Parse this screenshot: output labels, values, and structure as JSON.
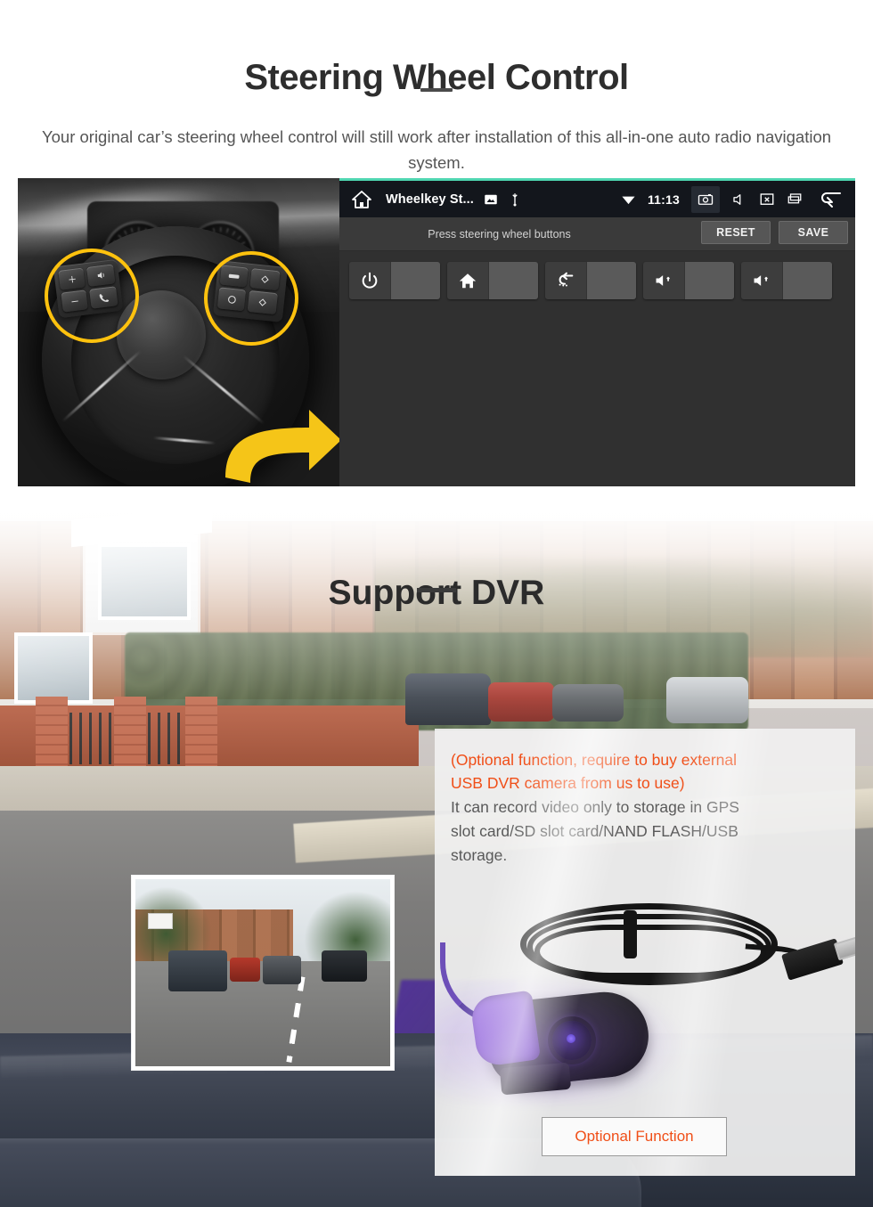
{
  "section1": {
    "title": "Steering Wheel Control",
    "subtitle": "Your original car’s steering wheel control will still work after installation of this all-in-one auto radio navigation system.",
    "photo_alt": "steering-wheel-photo",
    "head_unit": {
      "status_bar": {
        "home_icon": "home-icon",
        "app_title": "Wheelkey St...",
        "image_icon": "image-icon",
        "usb_icon": "usb-icon",
        "wifi_icon": "wifi-icon",
        "time": "11:13",
        "screenshot_icon": "screenshot-camera-icon",
        "mute_icon": "volume-mute-icon",
        "screen_off_icon": "screen-off-icon",
        "recents_icon": "recent-apps-icon",
        "back_icon": "back-arrow-icon"
      },
      "toolbar": {
        "hint": "Press steering wheel buttons",
        "reset_label": "RESET",
        "save_label": "SAVE"
      },
      "keys": [
        {
          "name": "power-key",
          "icon": "power-icon",
          "value": ""
        },
        {
          "name": "home-key",
          "icon": "home-icon",
          "value": ""
        },
        {
          "name": "back-key",
          "icon": "back-icon",
          "value": ""
        },
        {
          "name": "volume-up-key-1",
          "icon": "volume-up-icon",
          "value": ""
        },
        {
          "name": "volume-up-key-2",
          "icon": "volume-up-icon",
          "value": ""
        }
      ]
    },
    "highlight_color": "#ffc20e",
    "arrow_color": "#f5c518",
    "accent_top_border": "#4fd6b1"
  },
  "section2": {
    "title": "Support DVR",
    "info": {
      "red_line_1": "(Optional function, require to buy external",
      "red_line_2": "USB DVR camera from us to use)",
      "grey_line_1": "It can record video only to storage in GPS",
      "grey_line_2": "slot card/SD slot card/NAND FLASH/USB",
      "grey_line_3": "storage.",
      "red_color": "#f04e17",
      "grey_color": "#595959"
    },
    "optional_button": {
      "label": "Optional Function",
      "text_color": "#f04e17",
      "border_color": "#9a9a9a"
    },
    "inset_preview_alt": "dvr-recording-preview",
    "camera_product_alt": "usb-dvr-camera-product-photo",
    "background_alt": "dashcam-street-view-photo"
  }
}
